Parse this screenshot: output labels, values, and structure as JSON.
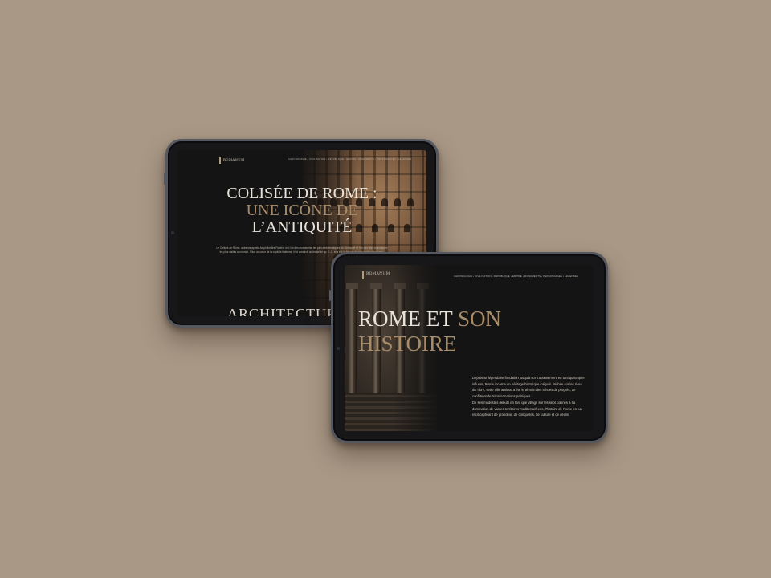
{
  "background_color": "#a99886",
  "accent_color": "#a88c6a",
  "tablet_one": {
    "logo": "ROMANUM",
    "nav": "CHRONOLOGIE • CIVILISATION • RÉPUBLIQUE • EMPIRE • MONUMENTS • PERSONNAGES • LÉGENDES",
    "title_line1": "COLISÉE DE ROME :",
    "title_line2": "UNE ICÔNE DE",
    "title_line3": "L’ANTIQUITÉ",
    "paragraph": "Le Colisée de Rome, autrefois appelé Amphithéâtre Flavien, est l’un des monuments les plus emblématiques de l’Antiquité et l’un des sites touristiques les plus visités au monde. Situé au cœur de la capitale italienne, il fut construit au Ier siècle ap. J.-C. et a été le théâtre de spectacles grandioses.",
    "section_heading": "ARCHITECTURE"
  },
  "tablet_two": {
    "logo": "ROMANUM",
    "nav": "CHRONOLOGIE • CIVILISATION • RÉPUBLIQUE • EMPIRE • MONUMENTS • PERSONNAGES • LÉGENDES",
    "title_white_1": "ROME ET ",
    "title_accent_1": "SON",
    "title_accent_2": "HISTOIRE",
    "paragraph_1": "Depuis sa légendaire fondation jusqu’à son rayonnement en tant qu’Empire influent, Rome incarne un héritage historique inégalé. Nichée sur les rives du Tibre, cette ville antique a été le témoin des siècles de progrès, de conflits et de transformations politiques.",
    "paragraph_2": "De ses modestes débuts en tant que village sur les sept collines à sa domination de vastes territoires méditerranéens, l’histoire de Rome est un récit captivant de grandeur, de conquêtes, de culture et de déclin."
  }
}
